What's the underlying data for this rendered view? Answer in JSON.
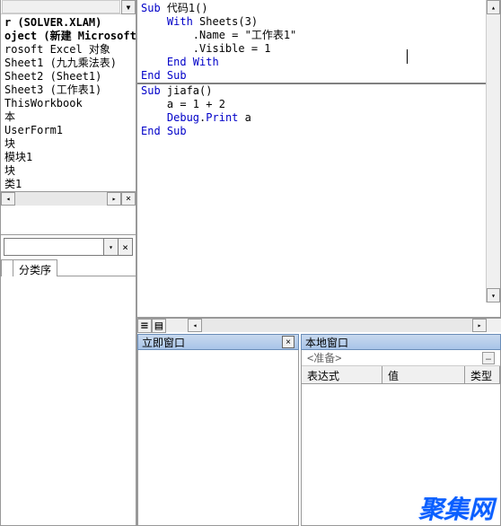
{
  "project_tree": {
    "items": [
      {
        "text": "r (SOLVER.XLAM)",
        "bold": true
      },
      {
        "text": "oject (新建 Microsoft",
        "bold": true
      },
      {
        "text": "rosoft Excel 对象",
        "bold": false
      },
      {
        "text": "Sheet1 (九九乘法表)",
        "bold": false
      },
      {
        "text": "Sheet2 (Sheet1)",
        "bold": false
      },
      {
        "text": "Sheet3 (工作表1)",
        "bold": false
      },
      {
        "text": "ThisWorkbook",
        "bold": false
      },
      {
        "text": "本",
        "bold": false
      },
      {
        "text": "UserForm1",
        "bold": false
      },
      {
        "text": "块",
        "bold": false
      },
      {
        "text": "模块1",
        "bold": false
      },
      {
        "text": "块",
        "bold": false
      },
      {
        "text": "类1",
        "bold": false
      }
    ]
  },
  "props": {
    "tabs": [
      "",
      "分类序"
    ],
    "dropdown": ""
  },
  "code": {
    "lines": [
      {
        "segs": [
          {
            "t": "Sub",
            "c": "kw"
          },
          {
            "t": " 代码1()",
            "c": ""
          }
        ]
      },
      {
        "segs": [
          {
            "t": "    ",
            "c": ""
          },
          {
            "t": "With",
            "c": "kw"
          },
          {
            "t": " Sheets(3)",
            "c": ""
          }
        ]
      },
      {
        "segs": [
          {
            "t": "        .Name = \"工作表1\"",
            "c": ""
          }
        ]
      },
      {
        "segs": [
          {
            "t": "        .Visible = 1",
            "c": ""
          }
        ]
      },
      {
        "segs": [
          {
            "t": "    ",
            "c": ""
          },
          {
            "t": "End With",
            "c": "kw"
          }
        ]
      },
      {
        "segs": [
          {
            "t": "End Sub",
            "c": "kw"
          }
        ]
      }
    ],
    "divider": true,
    "lines2": [
      {
        "segs": [
          {
            "t": "Sub",
            "c": "kw"
          },
          {
            "t": " jiafa()",
            "c": ""
          }
        ]
      },
      {
        "segs": [
          {
            "t": "    a = 1 + 2",
            "c": ""
          }
        ]
      },
      {
        "segs": [
          {
            "t": "    ",
            "c": ""
          },
          {
            "t": "Debug",
            "c": "kw"
          },
          {
            "t": ".",
            "c": ""
          },
          {
            "t": "Print",
            "c": "kw"
          },
          {
            "t": " a",
            "c": ""
          }
        ]
      },
      {
        "segs": [
          {
            "t": "End Sub",
            "c": "kw"
          }
        ]
      }
    ]
  },
  "immediate": {
    "title": "立即窗口"
  },
  "locals": {
    "title": "本地窗口",
    "ready": "<准备>",
    "headers": {
      "expr": "表达式",
      "val": "值",
      "type": "类型"
    }
  },
  "watermark": "聚集网"
}
